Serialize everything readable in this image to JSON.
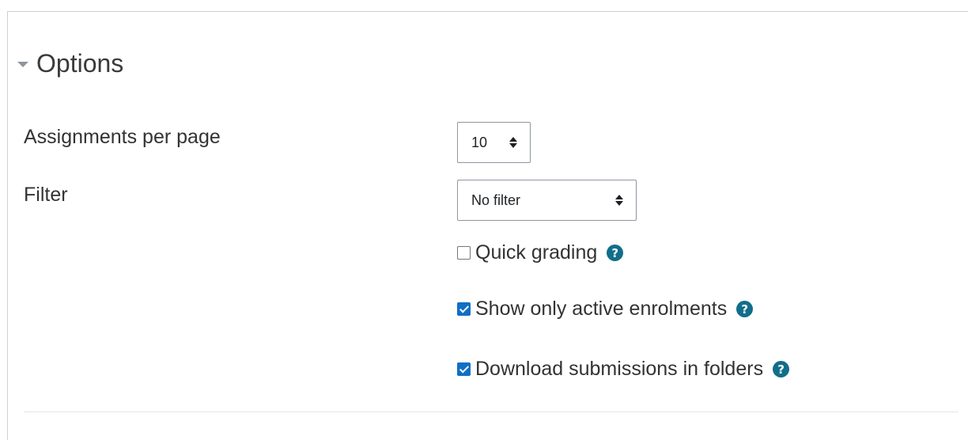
{
  "section": {
    "title": "Options"
  },
  "fields": {
    "assignments_per_page": {
      "label": "Assignments per page",
      "value": "10"
    },
    "filter": {
      "label": "Filter",
      "value": "No filter"
    }
  },
  "checkboxes": [
    {
      "label": "Quick grading",
      "checked": false
    },
    {
      "label": "Show only active enrolments",
      "checked": true
    },
    {
      "label": "Download submissions in folders",
      "checked": true
    }
  ],
  "icons": {
    "help": "help-circle-icon",
    "caret": "caret-down-icon",
    "select_arrows": "sort-arrows-icon"
  },
  "colors": {
    "checkbox_checked": "#0f6fc5",
    "help_icon": "#116e8a"
  }
}
